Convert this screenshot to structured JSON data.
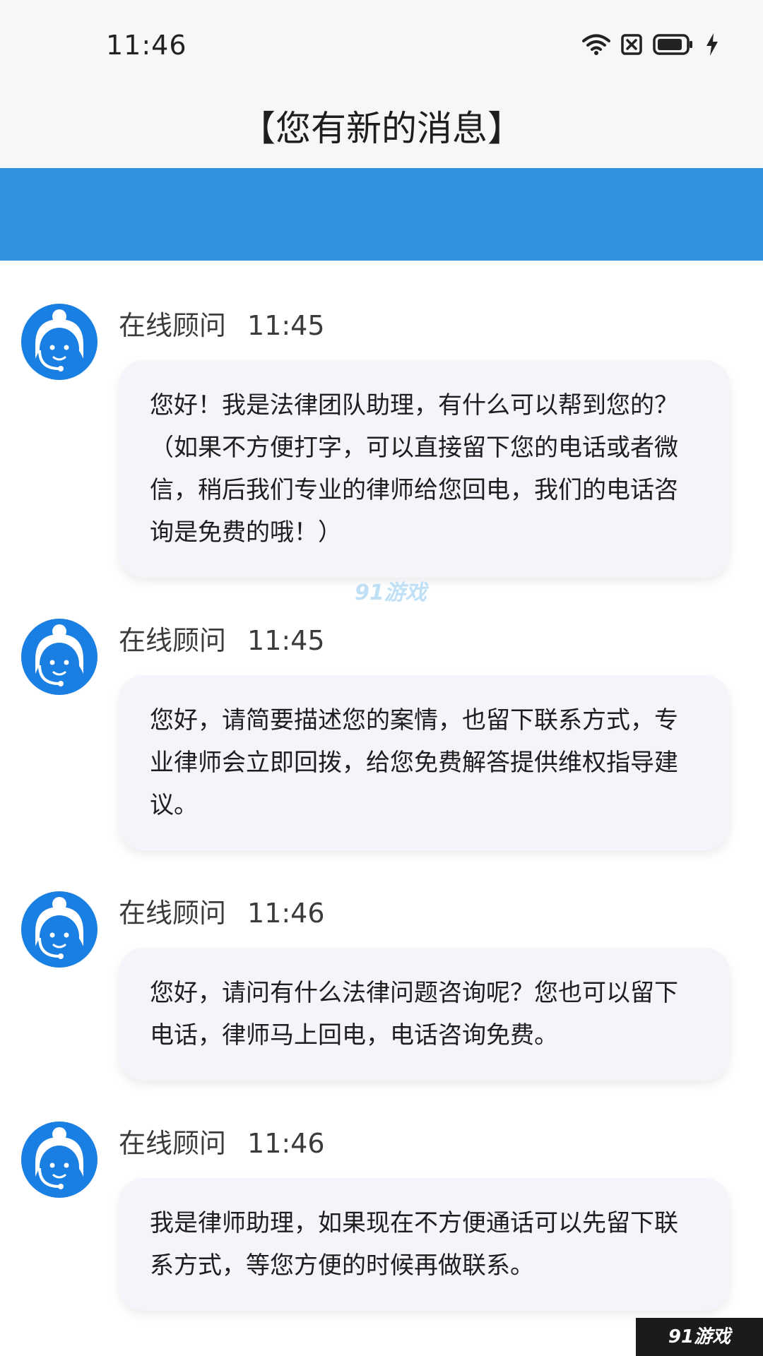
{
  "status_bar": {
    "time": "11:46"
  },
  "header": {
    "title": "【您有新的消息】"
  },
  "colors": {
    "banner": "#2f93e2",
    "avatar": "#1a7fe3",
    "bubble": "#f4f5fb"
  },
  "messages": [
    {
      "sender": "在线顾问",
      "time": "11:45",
      "text": "您好！我是法律团队助理，有什么可以帮到您的？（如果不方便打字，可以直接留下您的电话或者微信，稍后我们专业的律师给您回电，我们的电话咨询是免费的哦！）"
    },
    {
      "sender": "在线顾问",
      "time": "11:45",
      "text": "您好，请简要描述您的案情，也留下联系方式，专业律师会立即回拨，给您免费解答提供维权指导建议。"
    },
    {
      "sender": "在线顾问",
      "time": "11:46",
      "text": "您好，请问有什么法律问题咨询呢？您也可以留下电话，律师马上回电，电话咨询免费。"
    },
    {
      "sender": "在线顾问",
      "time": "11:46",
      "text": "我是律师助理，如果现在不方便通话可以先留下联系方式，等您方便的时候再做联系。"
    }
  ],
  "watermark": {
    "mid": "91游戏",
    "corner": "91游戏"
  }
}
